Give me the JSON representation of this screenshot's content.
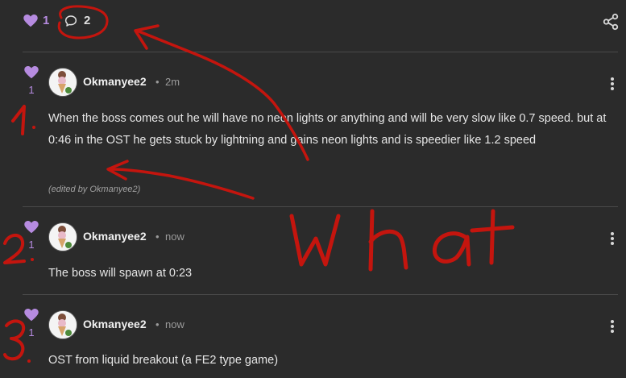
{
  "post": {
    "likes": "1",
    "comments": "2"
  },
  "comments": [
    {
      "likes": "1",
      "username": "Okmanyee2",
      "separator": "•",
      "time": "2m",
      "text": "When the boss comes out he will have no neon lights or anything and will be very slow like 0.7 speed. but at 0:46 in the OST he gets stuck by lightning and gains neon lights and is speedier like 1.2 speed",
      "edited": "(edited by Okmanyee2)"
    },
    {
      "likes": "1",
      "username": "Okmanyee2",
      "separator": "•",
      "time": "now",
      "text": "The boss will spawn at 0:23"
    },
    {
      "likes": "1",
      "username": "Okmanyee2",
      "separator": "•",
      "time": "now",
      "text": "OST from liquid breakout  (a FE2 type game)"
    }
  ],
  "annotations": {
    "numbers": [
      "1.",
      "2.",
      "3."
    ],
    "word": "What"
  },
  "colors": {
    "background": "#2b2b2b",
    "accent": "#b68be0",
    "ink": "#c4150e"
  },
  "icons": [
    "heart-icon",
    "comment-icon",
    "share-icon",
    "more-options-icon",
    "avatar"
  ]
}
